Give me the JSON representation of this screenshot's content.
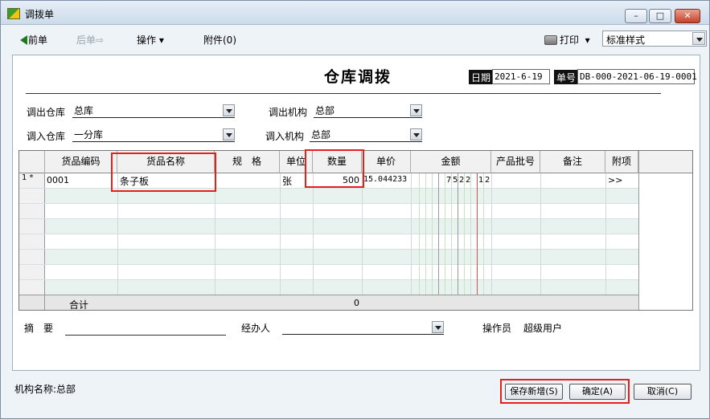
{
  "window": {
    "title": "调拨单"
  },
  "toolbar": {
    "prev": "前单",
    "next": "后单",
    "operations": "操作",
    "attachments": "附件(0)",
    "print": "打印",
    "style_value": "标准样式"
  },
  "form": {
    "title": "仓库调拨",
    "date_label": "日期",
    "date_value": "2021-6-19",
    "number_label": "单号",
    "number_value": "DB-000-2021-06-19-0001",
    "out_warehouse_label": "调出仓库",
    "out_warehouse_value": "总库",
    "out_org_label": "调出机构",
    "out_org_value": "总部",
    "in_warehouse_label": "调入仓库",
    "in_warehouse_value": "一分库",
    "in_org_label": "调入机构",
    "in_org_value": "总部"
  },
  "grid": {
    "columns": [
      "货品编码",
      "货品名称",
      "规　格",
      "单位",
      "数量",
      "单价",
      "金额",
      "产品批号",
      "备注",
      "附项"
    ],
    "rows": [
      {
        "num": "1 *",
        "code": "0001",
        "name": "条子板",
        "spec": "",
        "unit": "张",
        "qty": "500",
        "price": "15.044233",
        "amount_digits": [
          "7",
          "5",
          "2",
          "2",
          "1",
          "2"
        ],
        "batch": "",
        "note": "",
        "extra": ">>"
      }
    ],
    "total_label": "合计",
    "total_qty": "0"
  },
  "footer": {
    "summary_label": "摘　要",
    "handler_label": "经办人",
    "operator_label": "操作员",
    "operator_value": "超级用户"
  },
  "status": {
    "org_label": "机构名称:总部"
  },
  "buttons": {
    "save_new": "保存新增(S)",
    "ok": "确定(A)",
    "cancel": "取消(C)"
  },
  "colors": {
    "highlight": "#e3201b",
    "row_alt": "#e8f3ef",
    "accent_green": "#1e7a21"
  }
}
